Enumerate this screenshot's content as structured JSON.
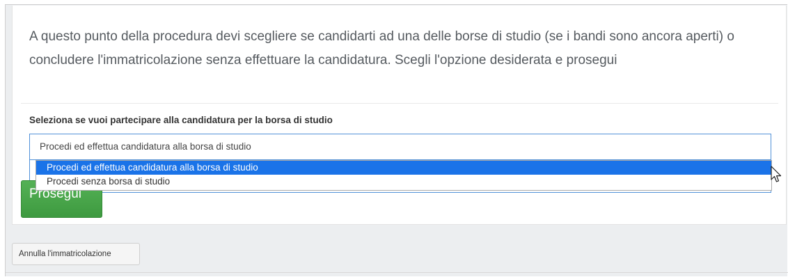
{
  "intro_text": "A questo punto della procedura devi scegliere se candidarti ad una delle borse di studio (se i bandi sono ancora aperti) o concludere l'immatricolazione senza effettuare la candidatura. Scegli l'opzione desiderata e prosegui",
  "form": {
    "label": "Seleziona se vuoi partecipare alla candidatura per la borsa di studio",
    "selected_value": "Procedi ed effettua candidatura alla borsa di studio",
    "options": [
      "Procedi ed effettua candidatura alla borsa di studio",
      "Procedi senza borsa di studio"
    ],
    "submit_label": "Prosegui"
  },
  "footer": {
    "cancel_label": "Annulla l'immatricolazione"
  },
  "colors": {
    "accent_green": "#3e9a40",
    "selection_blue": "#1a73e8",
    "focus_border": "#4f90d8"
  },
  "icons": {
    "cursor": "mouse-pointer-icon"
  }
}
